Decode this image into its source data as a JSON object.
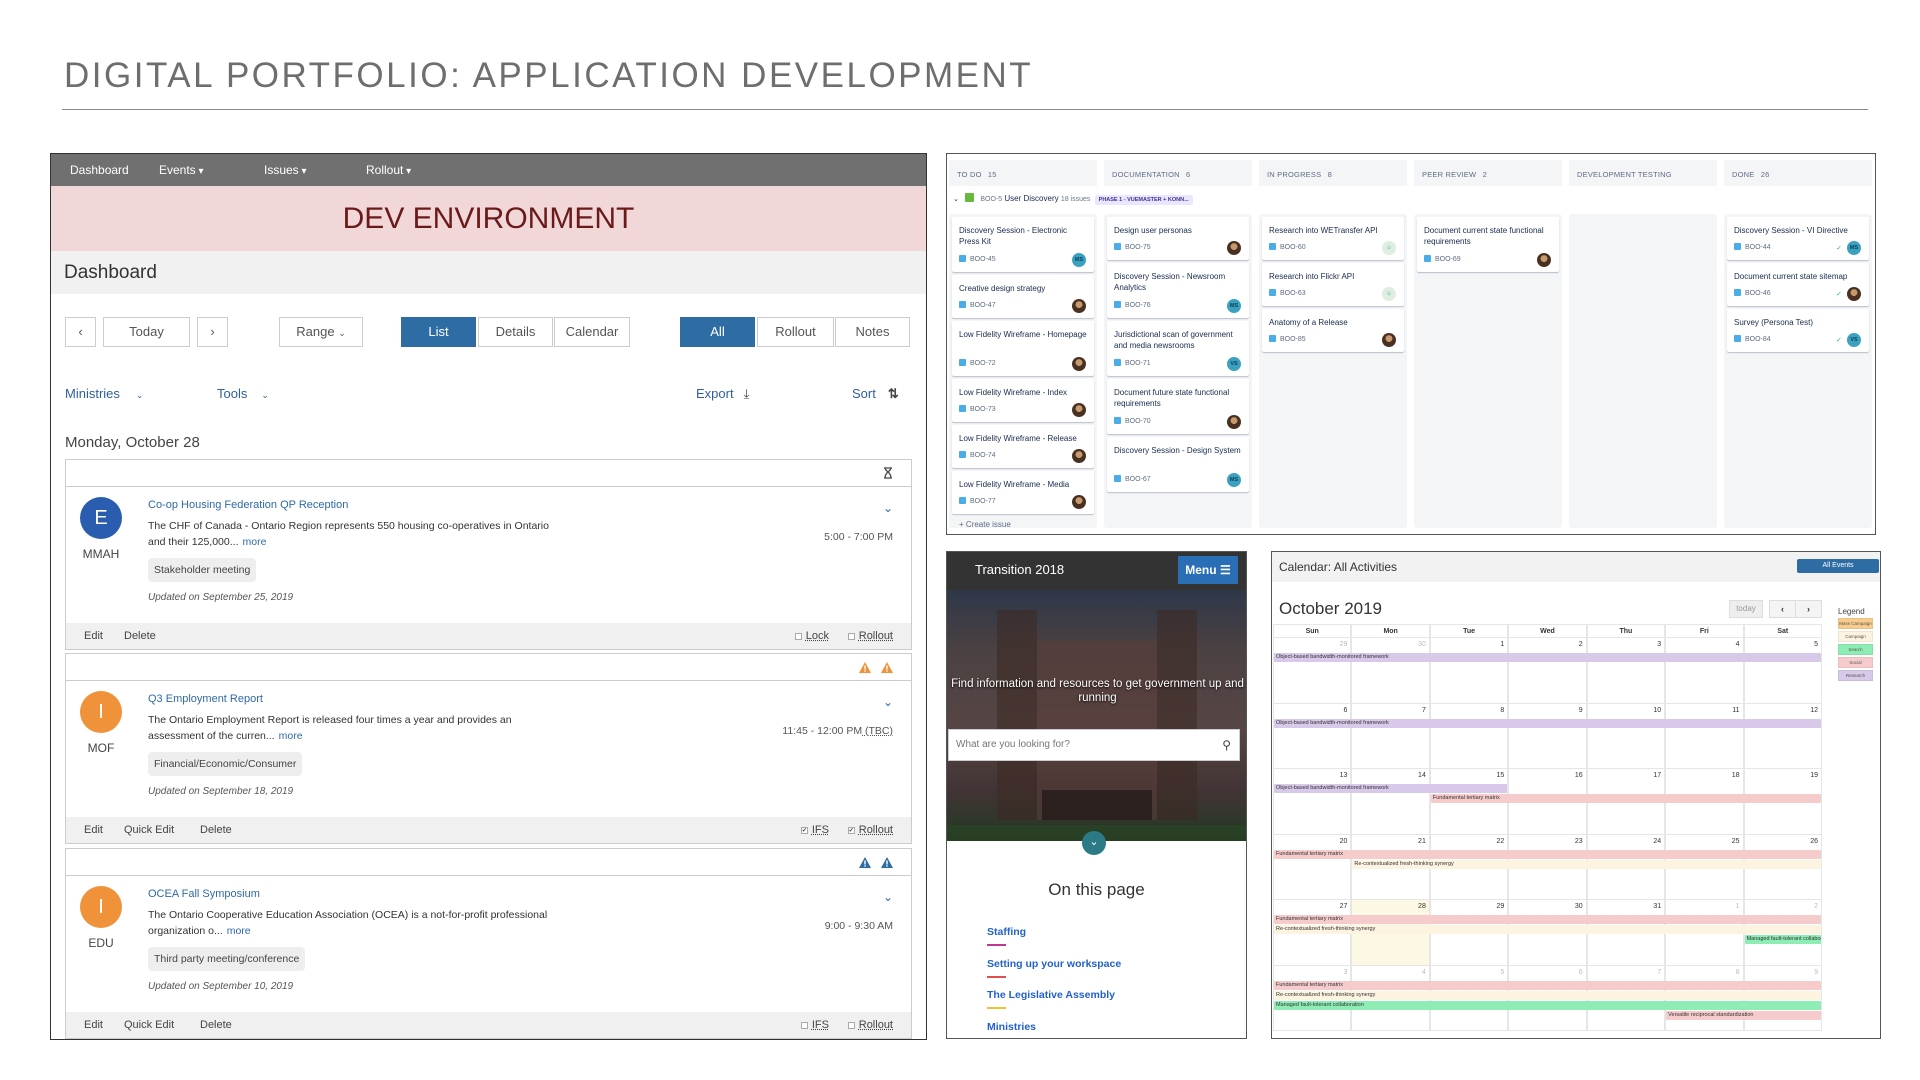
{
  "page": {
    "title": "DIGITAL PORTFOLIO: APPLICATION DEVELOPMENT"
  },
  "dashboard": {
    "nav": [
      {
        "label": "Dashboard",
        "dropdown": false
      },
      {
        "label": "Events",
        "dropdown": true
      },
      {
        "label": "Issues",
        "dropdown": true
      },
      {
        "label": "Rollout",
        "dropdown": true
      }
    ],
    "env_banner": "DEV ENVIRONMENT",
    "title": "Dashboard",
    "toolbar": {
      "prev": "‹",
      "today": "Today",
      "next": "›",
      "range": "Range",
      "views": [
        {
          "label": "List",
          "active": true
        },
        {
          "label": "Details",
          "active": false
        },
        {
          "label": "Calendar",
          "active": false
        }
      ],
      "filters": [
        {
          "label": "All",
          "active": true
        },
        {
          "label": "Rollout",
          "active": false
        },
        {
          "label": "Notes",
          "active": false
        }
      ]
    },
    "subbar": {
      "ministries": "Ministries",
      "tools": "Tools",
      "export": "Export",
      "sort": "Sort"
    },
    "day_heading": "Monday, October 28",
    "accent": "#2e6da4",
    "events": [
      {
        "header_icons": [
          "hourglass"
        ],
        "avatar_letter": "E",
        "avatar_color": "#2a5db0",
        "ministry": "MMAH",
        "title": "Co-op Housing Federation QP Reception",
        "desc": "The CHF of Canada - Ontario Region represents 550 housing co-operatives in Ontario and their 125,000...",
        "more": "more",
        "tag": "Stakeholder meeting",
        "updated": "Updated on September 25, 2019",
        "time": "5:00 - 7:00 PM",
        "time_note": "",
        "actions": [
          "Edit",
          "Delete"
        ],
        "checks": [
          {
            "label": "Lock",
            "checked": false
          },
          {
            "label": "Rollout",
            "checked": false
          }
        ]
      },
      {
        "header_icons": [
          "warning-orange",
          "warning-orange"
        ],
        "avatar_letter": "I",
        "avatar_color": "#f0923a",
        "ministry": "MOF",
        "title": "Q3 Employment Report",
        "desc": "The Ontario Employment Report is released four times a year and provides an assessment of the curren...",
        "more": "more",
        "tag": "Financial/Economic/Consumer",
        "updated": "Updated on September 18, 2019",
        "time": "11:45 - 12:00 PM",
        "time_note": "(TBC)",
        "actions": [
          "Edit",
          "Quick Edit",
          "Delete"
        ],
        "checks": [
          {
            "label": "IFS",
            "checked": true
          },
          {
            "label": "Rollout",
            "checked": true
          }
        ]
      },
      {
        "header_icons": [
          "warning-blue",
          "warning-blue"
        ],
        "avatar_letter": "I",
        "avatar_color": "#f0923a",
        "ministry": "EDU",
        "title": "OCEA Fall Symposium",
        "desc": "The Ontario Cooperative Education Association (OCEA) is a not-for-profit professional organization o...",
        "more": "more",
        "tag": "Third party meeting/conference",
        "updated": "Updated on September 10, 2019",
        "time": "9:00 - 9:30 AM",
        "time_note": "",
        "actions": [
          "Edit",
          "Quick Edit",
          "Delete"
        ],
        "checks": [
          {
            "label": "IFS",
            "checked": false
          },
          {
            "label": "Rollout",
            "checked": false
          }
        ]
      }
    ]
  },
  "kanban": {
    "epic": {
      "key": "BOO-5",
      "name": "User Discovery",
      "count": "18 issues",
      "label": "PHASE 1 - VUEMASTER + KONN..."
    },
    "create_issue": "Create issue",
    "columns": [
      {
        "name": "TO DO",
        "count": "15",
        "cards": [
          {
            "title": "Discovery Session - Electronic Press Kit",
            "key": "BOO-45",
            "avatar": "MS"
          },
          {
            "title": "Creative design strategy",
            "key": "BOO-47",
            "avatar": "photo"
          },
          {
            "title": "Low Fidelity Wireframe - Homepage",
            "key": "BOO-72",
            "avatar": "photo"
          },
          {
            "title": "Low Fidelity Wireframe - Index",
            "key": "BOO-73",
            "avatar": "photo"
          },
          {
            "title": "Low Fidelity Wireframe - Release",
            "key": "BOO-74",
            "avatar": "photo"
          },
          {
            "title": "Low Fidelity Wireframe - Media",
            "key": "BOO-77",
            "avatar": "photo"
          }
        ]
      },
      {
        "name": "DOCUMENTATION",
        "count": "6",
        "cards": [
          {
            "title": "Design user personas",
            "key": "BOO-75",
            "avatar": "photo"
          },
          {
            "title": "Discovery Session - Newsroom Analytics",
            "key": "BOO-76",
            "avatar": "MS"
          },
          {
            "title": "Jurisdictional scan of government and media newsrooms",
            "key": "BOO-71",
            "avatar": "VS"
          },
          {
            "title": "Document future state functional requirements",
            "key": "BOO-70",
            "avatar": "photo"
          },
          {
            "title": "Discovery Session - Design System",
            "key": "BOO-67",
            "avatar": "MS"
          }
        ]
      },
      {
        "name": "IN PROGRESS",
        "count": "8",
        "cards": [
          {
            "title": "Research into WETransfer API",
            "key": "BOO-60",
            "avatar": "bot"
          },
          {
            "title": "Research into Flickr API",
            "key": "BOO-63",
            "avatar": "bot"
          },
          {
            "title": "Anatomy of a Release",
            "key": "BOO-85",
            "avatar": "photo"
          }
        ]
      },
      {
        "name": "PEER REVIEW",
        "count": "2",
        "cards": [
          {
            "title": "Document current state functional requirements",
            "key": "BOO-69",
            "avatar": "photo"
          }
        ]
      },
      {
        "name": "DEVELOPMENT TESTING",
        "count": "",
        "cards": []
      },
      {
        "name": "DONE",
        "count": "26",
        "cards": [
          {
            "title": "Discovery Session - VI Directive",
            "key": "BOO-44",
            "avatar": "MS",
            "done": true
          },
          {
            "title": "Document current state sitemap",
            "key": "BOO-46",
            "avatar": "photo",
            "done": true
          },
          {
            "title": "Survey (Persona Test)",
            "key": "BOO-84",
            "avatar": "VS",
            "done": true
          }
        ]
      }
    ]
  },
  "transition": {
    "title": "Transition 2018",
    "menu": "Menu",
    "headline": "Find information and resources to get government up and running",
    "search_placeholder": "What are you looking for?",
    "on_this_page": "On this page",
    "links": [
      {
        "label": "Staffing",
        "color": "#c2388f"
      },
      {
        "label": "Setting up your workspace",
        "color": "#e04f4f"
      },
      {
        "label": "The Legislative Assembly",
        "color": "#f2c232"
      },
      {
        "label": "Ministries",
        "color": "#2f7a3a"
      }
    ]
  },
  "calendar": {
    "title": "Calendar: All Activities",
    "all_events": "All Events",
    "month": "October 2019",
    "today_btn": "today",
    "prev": "‹",
    "next": "›",
    "today": "2019-10-28",
    "weekdays": [
      "Sun",
      "Mon",
      "Tue",
      "Wed",
      "Thu",
      "Fri",
      "Sat"
    ],
    "legend_title": "Legend",
    "legend": [
      {
        "label": "Mass Campaign",
        "color": "#f7cc8c"
      },
      {
        "label": "Campaign",
        "color": "#fdf3e1"
      },
      {
        "label": "Search",
        "color": "#8eedb4"
      },
      {
        "label": "Social",
        "color": "#f6cbcb"
      },
      {
        "label": "Research",
        "color": "#d8c8ea"
      }
    ],
    "events": [
      {
        "title": "Object-based bandwidth-monitored framework",
        "category": "Research",
        "start": "2019-09-29",
        "end": "2019-10-15"
      },
      {
        "title": "Fundamental tertiary matrix",
        "category": "Social",
        "start": "2019-10-15",
        "end": "2019-11-09"
      },
      {
        "title": "Re-contextualized fresh-thinking synergy",
        "category": "Campaign",
        "start": "2019-10-21",
        "end": "2019-11-09"
      },
      {
        "title": "Managed fault-tolerant collaboration",
        "category": "Search",
        "start": "2019-11-02",
        "end": "2019-11-09"
      },
      {
        "title": "Versatile reciprocal standardization",
        "category": "Social",
        "start": "2019-11-08",
        "end": "2019-11-09"
      }
    ]
  }
}
